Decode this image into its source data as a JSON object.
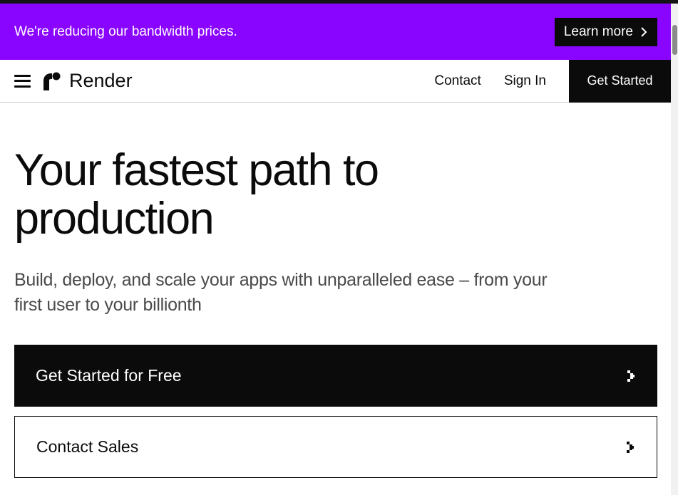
{
  "banner": {
    "text": "We're reducing our bandwidth prices.",
    "button_label": "Learn more",
    "button_icon": "chevron-right-icon",
    "color": "#8a05ff"
  },
  "nav": {
    "menu_icon": "hamburger-menu-icon",
    "logo_text": "Render",
    "logo_icon": "render-logo-icon",
    "links": [
      {
        "label": "Contact"
      },
      {
        "label": "Sign In"
      }
    ],
    "cta_label": "Get Started"
  },
  "hero": {
    "title": "Your fastest path to production",
    "subtitle": "Build, deploy, and scale your apps with unparalleled ease – from your first user to your billionth",
    "primary_button": {
      "label": "Get Started for Free",
      "icon": "chevron-right-icon"
    },
    "secondary_button": {
      "label": "Contact Sales",
      "icon": "chevron-right-icon"
    }
  }
}
